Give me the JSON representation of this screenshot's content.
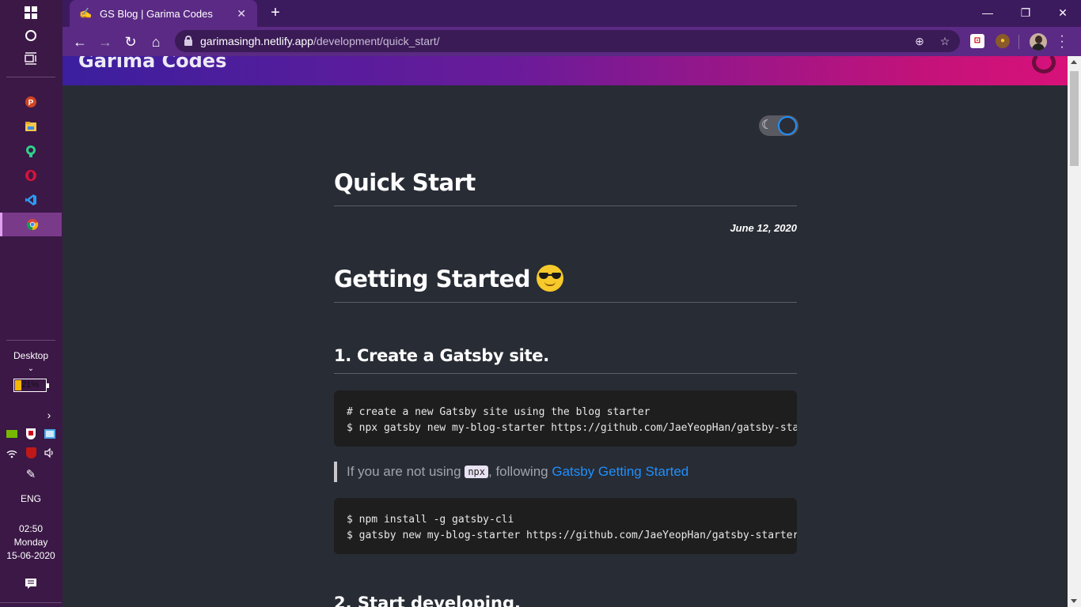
{
  "taskbar": {
    "desktop_label": "Desktop",
    "battery_text": "21%",
    "battery_level": 0.21,
    "language": "ENG",
    "clock": {
      "time": "02:50",
      "day": "Monday",
      "date": "15-06-2020"
    },
    "pinned_apps": [
      "powerpoint-icon",
      "file-explorer-icon",
      "podcast-icon",
      "opera-icon",
      "vscode-icon",
      "chrome-icon"
    ]
  },
  "browser": {
    "tab": {
      "title": "GS Blog | Garima Codes",
      "favicon": "✍"
    },
    "url": {
      "host": "garimasingh.netlify.app",
      "path": "/development/quick_start/"
    }
  },
  "page": {
    "site_title": "Garima Codes",
    "post_title": "Quick Start",
    "post_date": "June 12, 2020",
    "section_title": "Getting Started",
    "step1_title": "1. Create a Gatsby site.",
    "code1": {
      "line1": "# create a new Gatsby site using the blog starter",
      "line2": "$ npx gatsby new my-blog-starter https://github.com/JaeYeopHan/gatsby-starter-bee"
    },
    "quote": {
      "prefix": "If you are not using ",
      "code": "npx",
      "middle": ", following ",
      "link": "Gatsby Getting Started"
    },
    "code2": {
      "line1": "$ npm install -g gatsby-cli",
      "line2": "$ gatsby new my-blog-starter https://github.com/JaeYeopHan/gatsby-starter-bee"
    },
    "step2_title": "2. Start developing."
  },
  "colors": {
    "taskbar": "#3b1846",
    "tab_active": "#5a2a84",
    "page_bg": "#282c35",
    "link": "#1e90ff"
  }
}
